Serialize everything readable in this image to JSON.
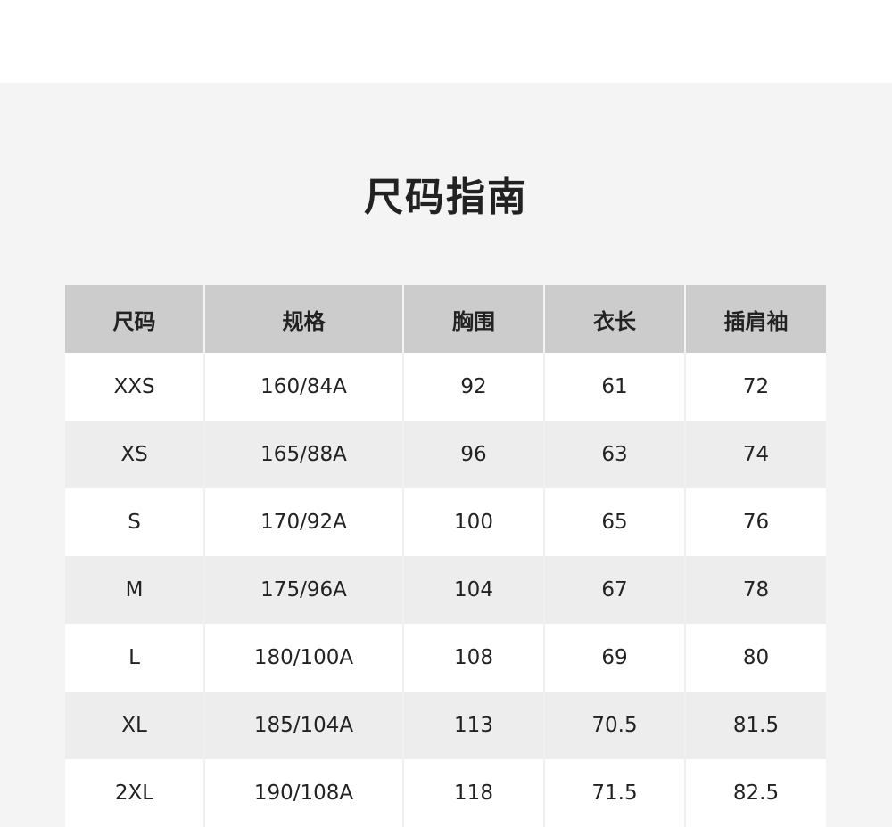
{
  "page": {
    "title": "尺码指南"
  },
  "size_table": {
    "headers": [
      "尺码",
      "规格",
      "胸围",
      "衣长",
      "插肩袖"
    ],
    "rows": [
      [
        "XXS",
        "160/84A",
        "92",
        "61",
        "72"
      ],
      [
        "XS",
        "165/88A",
        "96",
        "63",
        "74"
      ],
      [
        "S",
        "170/92A",
        "100",
        "65",
        "76"
      ],
      [
        "M",
        "175/96A",
        "104",
        "67",
        "78"
      ],
      [
        "L",
        "180/100A",
        "108",
        "69",
        "80"
      ],
      [
        "XL",
        "185/104A",
        "113",
        "70.5",
        "81.5"
      ],
      [
        "2XL",
        "190/108A",
        "118",
        "71.5",
        "82.5"
      ]
    ]
  },
  "colors": {
    "header_bg": "#cccccc",
    "panel_bg": "#f4f4f4",
    "row_alt_bg": "#ededed",
    "text": "#222222"
  }
}
